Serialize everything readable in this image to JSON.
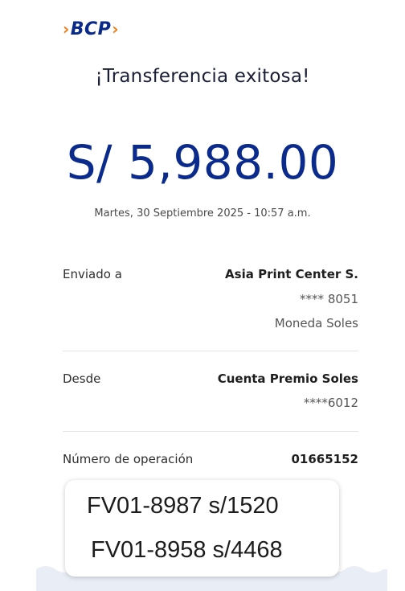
{
  "brand": {
    "name": "BCP",
    "accent_color": "#f07c16",
    "primary_color": "#0b2b8c"
  },
  "receipt": {
    "title": "¡Transferencia exitosa!",
    "amount": "S/ 5,988.00",
    "datetime": "Martes, 30 Septiembre 2025 - 10:57 a.m.",
    "sent_to": {
      "label": "Enviado a",
      "name": "Asia Print Center S.",
      "account": "**** 8051",
      "currency": "Moneda Soles"
    },
    "from": {
      "label": "Desde",
      "name": "Cuenta Premio Soles",
      "account": "****6012"
    },
    "operation": {
      "label": "Número de operación",
      "number": "01665152"
    }
  },
  "note": {
    "lines": [
      "FV01-8987 s/1520",
      "FV01-8958 s/4468"
    ]
  }
}
